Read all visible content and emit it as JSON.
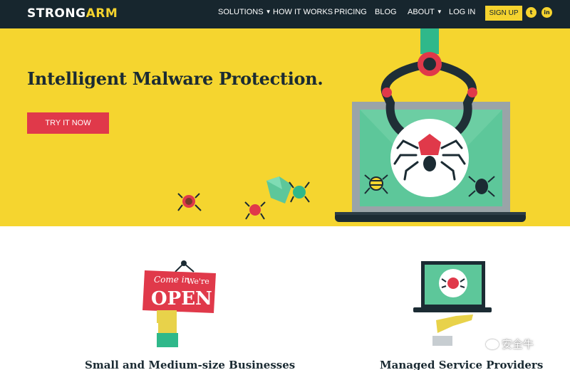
{
  "brand": {
    "part1": "STRONG",
    "part2": "ARM"
  },
  "nav": {
    "items": [
      {
        "label": "SOLUTIONS",
        "has_dropdown": true
      },
      {
        "label": "HOW IT WORKS",
        "has_dropdown": false
      },
      {
        "label": "PRICING",
        "has_dropdown": false
      },
      {
        "label": "BLOG",
        "has_dropdown": false
      },
      {
        "label": "ABOUT",
        "has_dropdown": true
      },
      {
        "label": "LOG IN",
        "has_dropdown": false
      }
    ],
    "signup_label": "SIGN UP",
    "social": [
      {
        "icon": "twitter-icon",
        "glyph": "t"
      },
      {
        "icon": "linkedin-icon",
        "glyph": "in"
      }
    ]
  },
  "hero": {
    "title": "Intelligent Malware Protection.",
    "cta_label": "TRY IT NOW",
    "sign": {
      "line1_a": "Come in",
      "line1_b": "We're",
      "line2": "OPEN"
    }
  },
  "features": [
    {
      "title": "Small and Medium-size Businesses"
    },
    {
      "title": "Managed Service Providers"
    }
  ],
  "watermark": "安全牛",
  "colors": {
    "nav_bg": "#17262e",
    "hero_bg": "#f5d52f",
    "accent_yellow": "#f5d32e",
    "cta_red": "#e0394a",
    "screen_green": "#5dc79a",
    "dark_text": "#1b2b33"
  }
}
